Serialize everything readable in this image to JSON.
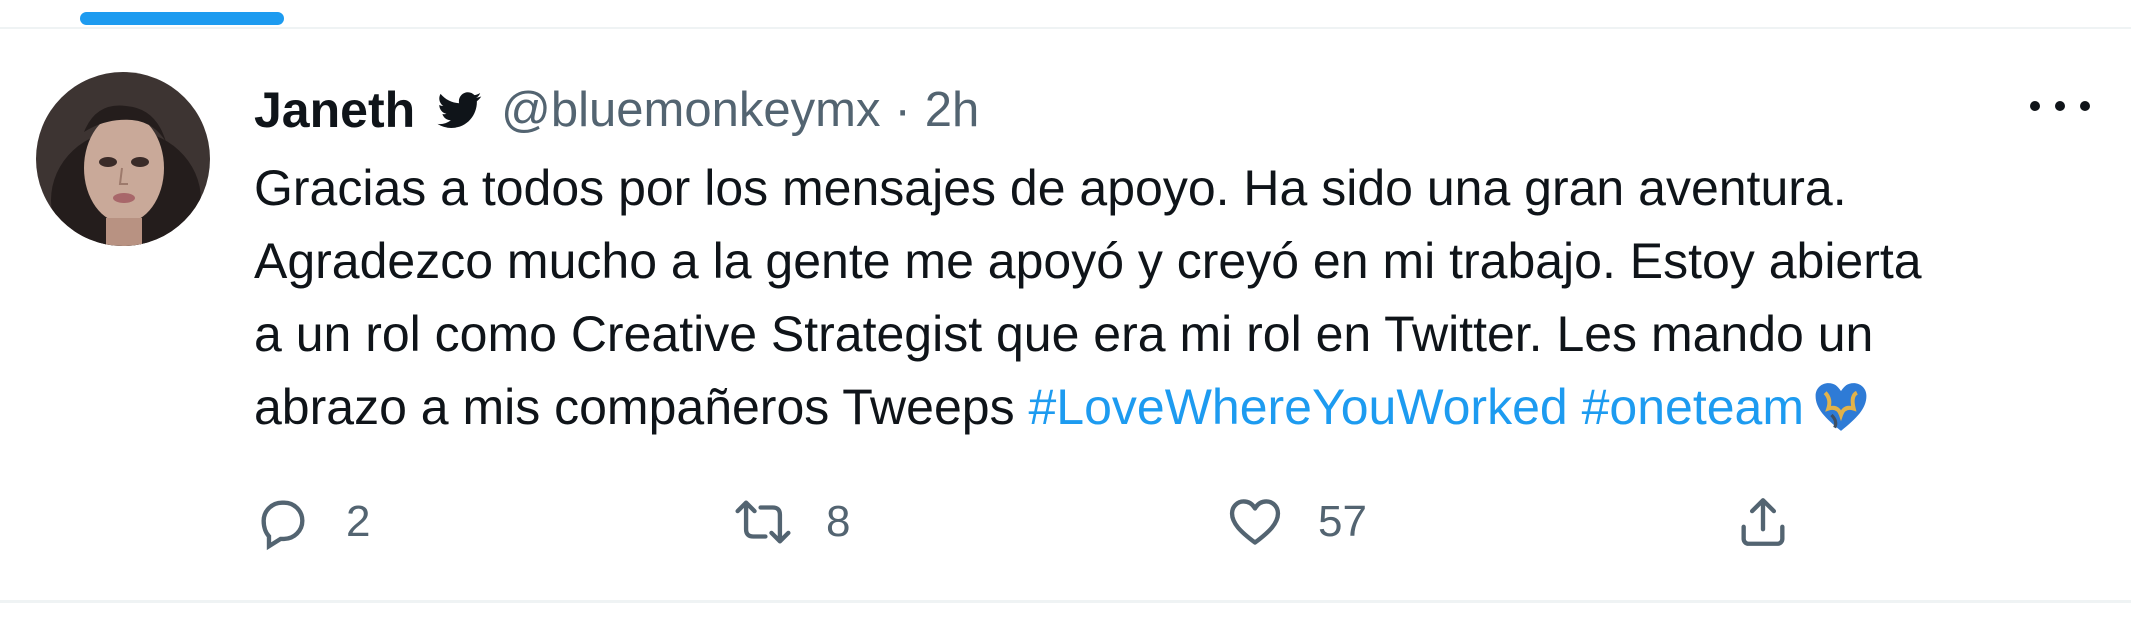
{
  "colors": {
    "accent": "#1d9bf0",
    "text_primary": "#0f1419",
    "text_secondary": "#536471",
    "divider": "#eff3f4"
  },
  "tweet": {
    "author": {
      "display_name": "Janeth",
      "handle": "@bluemonkeymx",
      "separator": "·",
      "time": "2h",
      "badge_icon": "twitter-bird-icon",
      "avatar": "avatar-photo"
    },
    "more_icon": "more-horizontal-icon",
    "text": {
      "line1": "Gracias a todos por los mensajes de apoyo. Ha sido una gran aventura.",
      "line2": "Agradezco mucho a la gente me apoyó y creyó en mi trabajo. Estoy abierta",
      "line3": "a un rol como Creative Strategist que era mi rol en Twitter. Les mando un",
      "line4_plain": "abrazo a mis compañeros Tweeps ",
      "hashtag1": "#LoveWhereYouWorked",
      "hashtag2": "#oneteam",
      "emoji": "blue-heart-globe-emoji"
    },
    "actions": {
      "reply": {
        "icon": "reply-icon",
        "count": "2"
      },
      "retweet": {
        "icon": "retweet-icon",
        "count": "8"
      },
      "like": {
        "icon": "heart-icon",
        "count": "57"
      },
      "share": {
        "icon": "share-icon"
      }
    }
  }
}
